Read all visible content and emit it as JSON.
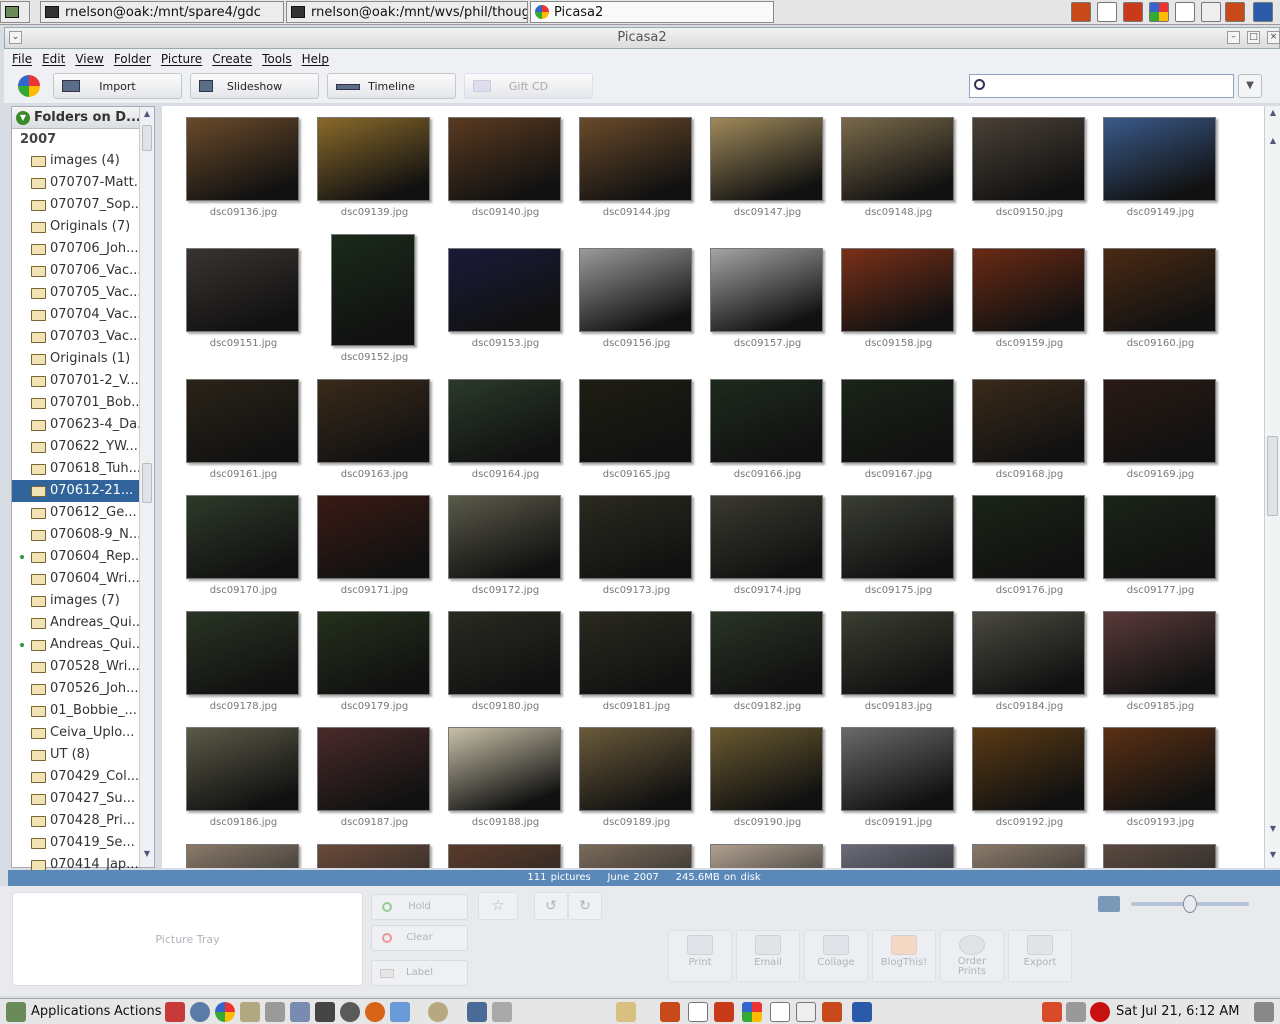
{
  "taskbar": {
    "tasks": [
      "rnelson@oak:/mnt/spare4/gdc",
      "rnelson@oak:/mnt/wvs/phil/thoughtlet",
      "Picasa2"
    ]
  },
  "window": {
    "title": "Picasa2"
  },
  "menu": [
    "File",
    "Edit",
    "View",
    "Folder",
    "Picture",
    "Create",
    "Tools",
    "Help"
  ],
  "toolbar": {
    "import": "Import",
    "slideshow": "Slideshow",
    "timeline": "Timeline",
    "gift_cd": "Gift CD"
  },
  "search": {
    "value": ""
  },
  "sidebar": {
    "header": "Folders on D...",
    "year": "2007",
    "folders": [
      {
        "label": "images (4)"
      },
      {
        "label": "070707-Matt..."
      },
      {
        "label": "070707_Sop..."
      },
      {
        "label": "Originals (7)"
      },
      {
        "label": "070706_Joh..."
      },
      {
        "label": "070706_Vac..."
      },
      {
        "label": "070705_Vac..."
      },
      {
        "label": "070704_Vac..."
      },
      {
        "label": "070703_Vac..."
      },
      {
        "label": "Originals (1)"
      },
      {
        "label": "070701-2_V..."
      },
      {
        "label": "070701_Bob..."
      },
      {
        "label": "070623-4_Da..."
      },
      {
        "label": "070622_YW..."
      },
      {
        "label": "070618_Tuh..."
      },
      {
        "label": "070612-21...",
        "selected": true
      },
      {
        "label": "070612_Ge..."
      },
      {
        "label": "070608-9_N..."
      },
      {
        "label": "070604_Rep...",
        "dot": true
      },
      {
        "label": "070604_Wri..."
      },
      {
        "label": "images (7)"
      },
      {
        "label": "Andreas_Qui..."
      },
      {
        "label": "Andreas_Qui...",
        "dot": true
      },
      {
        "label": "070528_Wri..."
      },
      {
        "label": "070526_Joh..."
      },
      {
        "label": "01_Bobbie_..."
      },
      {
        "label": "Ceiva_Uplo..."
      },
      {
        "label": "UT (8)"
      },
      {
        "label": "070429_Col..."
      },
      {
        "label": "070427_Su..."
      },
      {
        "label": "070428_Pri..."
      },
      {
        "label": "070419_Se..."
      },
      {
        "label": "070414_Jap..."
      }
    ]
  },
  "grid": {
    "rows": [
      [
        "dsc09136.jpg",
        "dsc09139.jpg",
        "dsc09140.jpg",
        "dsc09144.jpg",
        "dsc09147.jpg",
        "dsc09148.jpg",
        "dsc09150.jpg",
        "dsc09149.jpg"
      ],
      [
        "dsc09151.jpg",
        "dsc09152.jpg",
        "dsc09153.jpg",
        "dsc09156.jpg",
        "dsc09157.jpg",
        "dsc09158.jpg",
        "dsc09159.jpg",
        "dsc09160.jpg"
      ],
      [
        "dsc09161.jpg",
        "dsc09163.jpg",
        "dsc09164.jpg",
        "dsc09165.jpg",
        "dsc09166.jpg",
        "dsc09167.jpg",
        "dsc09168.jpg",
        "dsc09169.jpg"
      ],
      [
        "dsc09170.jpg",
        "dsc09171.jpg",
        "dsc09172.jpg",
        "dsc09173.jpg",
        "dsc09174.jpg",
        "dsc09175.jpg",
        "dsc09176.jpg",
        "dsc09177.jpg"
      ],
      [
        "dsc09178.jpg",
        "dsc09179.jpg",
        "dsc09180.jpg",
        "dsc09181.jpg",
        "dsc09182.jpg",
        "dsc09183.jpg",
        "dsc09184.jpg",
        "dsc09185.jpg"
      ],
      [
        "dsc09186.jpg",
        "dsc09187.jpg",
        "dsc09188.jpg",
        "dsc09189.jpg",
        "dsc09190.jpg",
        "dsc09191.jpg",
        "dsc09192.jpg",
        "dsc09193.jpg"
      ]
    ],
    "thumb_colors": [
      [
        "#6a4a2a",
        "#8a6a2a",
        "#5a3a20",
        "#6a4a2a",
        "#a08a5a",
        "#7a6a4a",
        "#4a4036",
        "#3a5a8a"
      ],
      [
        "#3a3430",
        "#1a2a1a",
        "#1a1a3a",
        "#9a9a9a",
        "#a4a4a4",
        "#7a3018",
        "#6a2a14",
        "#4a2a14"
      ],
      [
        "#2a2418",
        "#3a2a1a",
        "#2a3a2a",
        "#1e1e14",
        "#1e2a1e",
        "#1a2418",
        "#3a2a1a",
        "#2a1a14"
      ],
      [
        "#2e3a2a",
        "#3a1a14",
        "#5a5a4a",
        "#2a2a20",
        "#3a3a30",
        "#3a3e34",
        "#1a2416",
        "#1a2418"
      ],
      [
        "#2a3424",
        "#24301c",
        "#2a2a22",
        "#2a2a20",
        "#2a3426",
        "#3a3e30",
        "#4a4a40",
        "#5a3a3a"
      ],
      [
        "#5a5a48",
        "#4a2a2a",
        "#c8c0a8",
        "#6a5a3a",
        "#6a5a30",
        "#6a6a6a",
        "#5a3a14",
        "#5a3014"
      ]
    ],
    "partial_row_colors": [
      "#8a7a6a",
      "#6a4a3a",
      "#5a3a2a",
      "#7a6a5a",
      "#b0a090",
      "#6a6a7a",
      "#8a7a6a",
      "#5a4a40"
    ]
  },
  "status": {
    "count": "111 pictures",
    "date": "June 2007",
    "size": "245.6MB on disk"
  },
  "tray": {
    "label": "Picture Tray",
    "hold": "Hold",
    "clear": "Clear",
    "label_btn": "Label"
  },
  "actions": [
    "Print",
    "Email",
    "Collage",
    "BlogThis!",
    "Order Prints",
    "Export"
  ],
  "panel": {
    "applications": "Applications",
    "actions": "Actions",
    "clock": "Sat Jul 21,  6:12 AM"
  }
}
